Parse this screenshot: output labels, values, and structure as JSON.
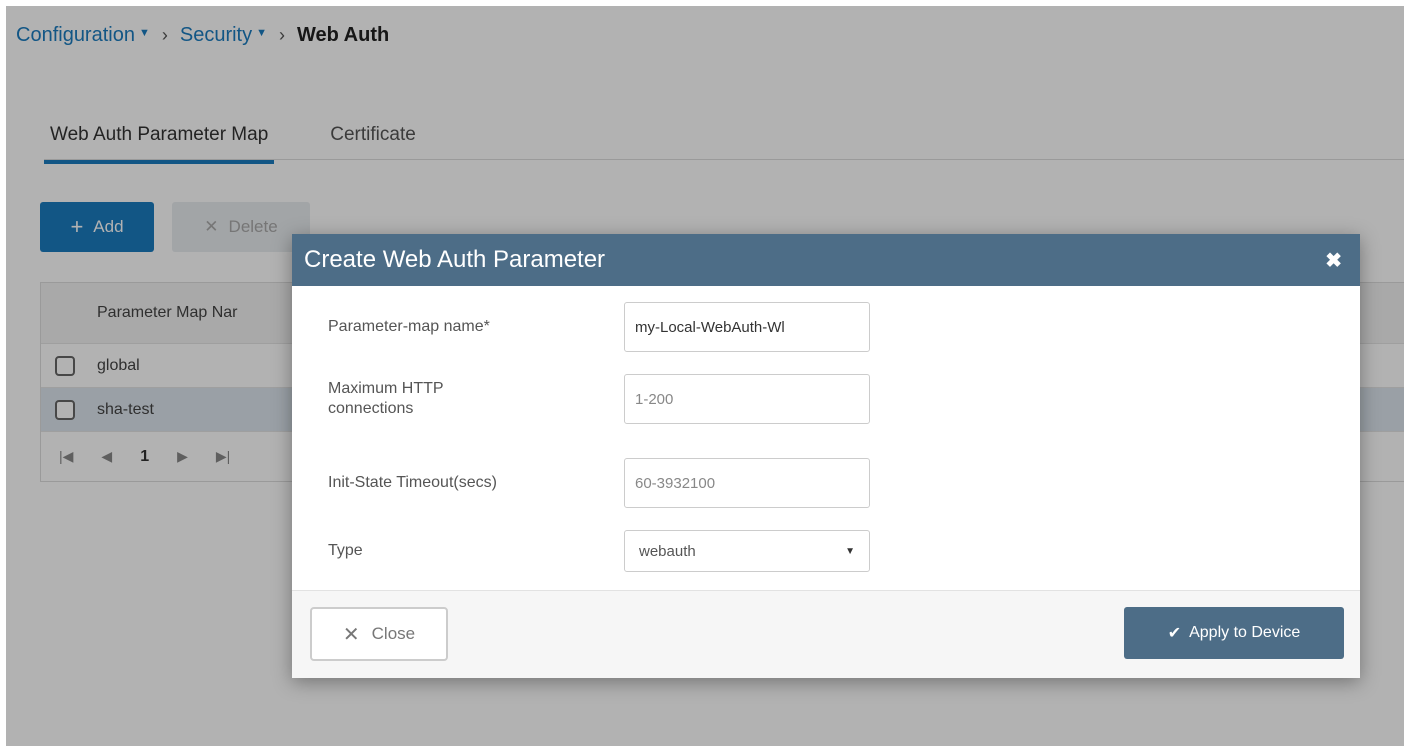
{
  "breadcrumb": {
    "items": [
      "Configuration",
      "Security"
    ],
    "current": "Web Auth"
  },
  "tabs": [
    {
      "label": "Web Auth Parameter Map",
      "active": true
    },
    {
      "label": "Certificate",
      "active": false
    }
  ],
  "toolbar": {
    "add_label": "Add",
    "delete_label": "Delete"
  },
  "table": {
    "column_header": "Parameter Map Nar",
    "rows": [
      {
        "name": "global",
        "selected": false
      },
      {
        "name": "sha-test",
        "selected": true
      }
    ],
    "pager": {
      "page": "1"
    }
  },
  "modal": {
    "title": "Create Web Auth Parameter",
    "fields": {
      "name": {
        "label": "Parameter-map name*",
        "value": "my-Local-WebAuth-Wl"
      },
      "max_http": {
        "label": "Maximum HTTP connections",
        "placeholder": "1-200"
      },
      "timeout": {
        "label": "Init-State Timeout(secs)",
        "placeholder": "60-3932100"
      },
      "type": {
        "label": "Type",
        "value": "webauth"
      }
    },
    "close_label": "Close",
    "apply_label": "Apply to Device"
  },
  "colors": {
    "accent": "#1a7bbf",
    "modal_header": "#4d6d87"
  }
}
